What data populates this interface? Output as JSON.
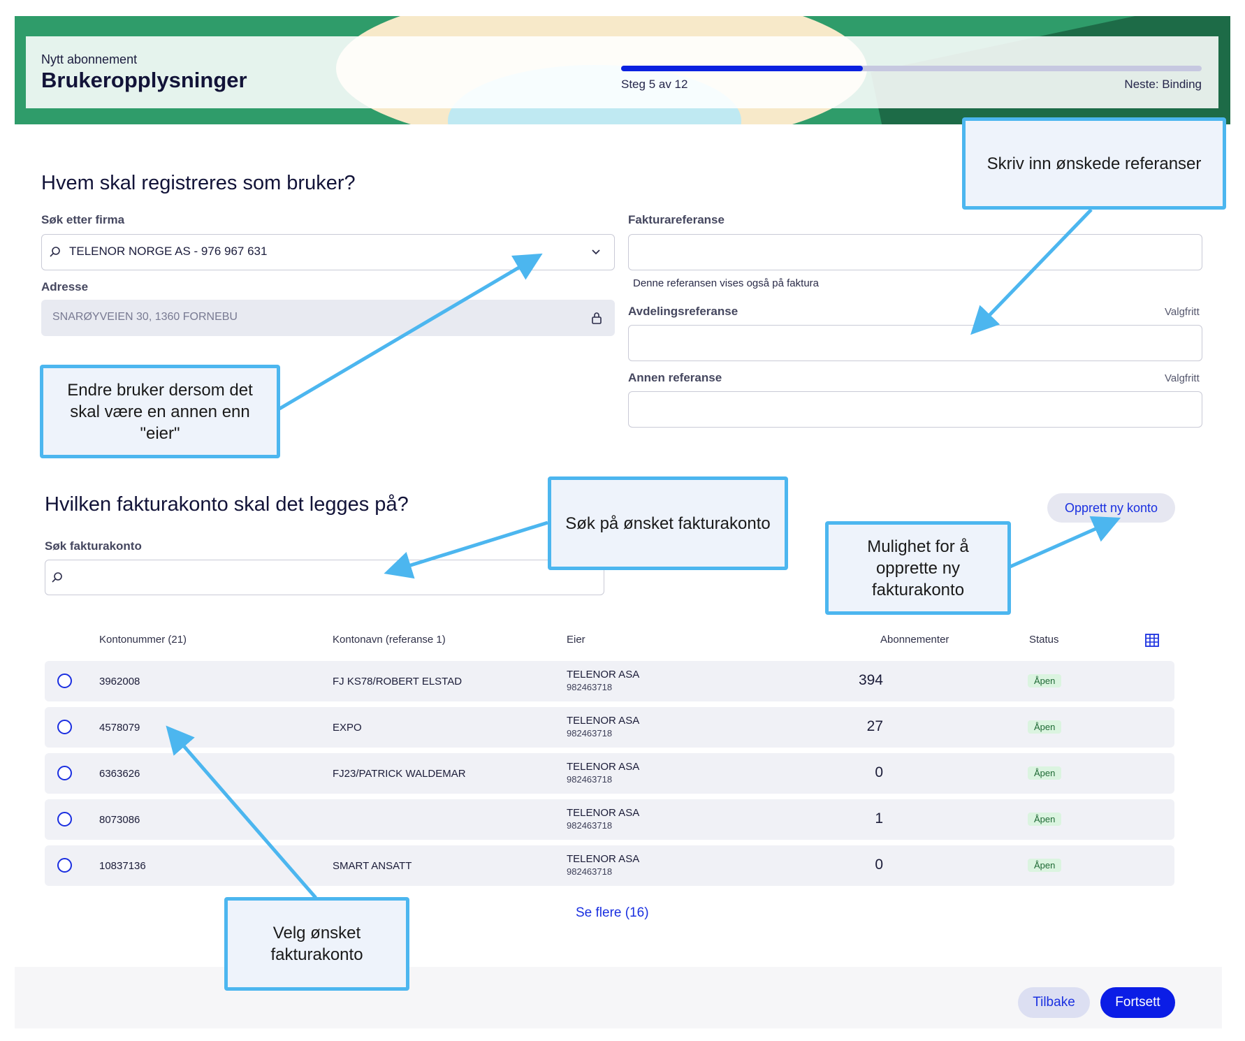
{
  "header": {
    "subtitle": "Nytt abonnement",
    "title": "Brukeropplysninger",
    "step_label": "Steg 5 av 12",
    "next_label": "Neste: Binding",
    "progress_fraction": 0.4167
  },
  "user_section": {
    "heading": "Hvem skal registreres som bruker?",
    "company_search_label": "Søk etter firma",
    "company_value": "TELENOR NORGE AS - 976 967 631",
    "address_label": "Adresse",
    "address_value": "SNARØYVEIEN 30, 1360 FORNEBU",
    "invoice_ref_label": "Fakturareferanse",
    "invoice_ref_value": "",
    "invoice_ref_hint": "Denne referansen vises også på faktura",
    "dept_ref_label": "Avdelingsreferanse",
    "dept_ref_value": "",
    "other_ref_label": "Annen referanse",
    "other_ref_value": "",
    "optional_label": "Valgfritt"
  },
  "account_section": {
    "heading": "Hvilken fakturakonto skal det legges på?",
    "search_label": "Søk fakturakonto",
    "search_value": "",
    "create_button": "Opprett ny konto",
    "columns": {
      "account_number": "Kontonummer (21)",
      "account_name": "Kontonavn (referanse 1)",
      "owner": "Eier",
      "subscriptions": "Abonnementer",
      "status": "Status"
    },
    "rows": [
      {
        "number": "3962008",
        "name": "FJ KS78/ROBERT ELSTAD",
        "owner": "TELENOR ASA",
        "org": "982463718",
        "subscriptions": "394",
        "status": "Åpen"
      },
      {
        "number": "4578079",
        "name": "EXPO",
        "owner": "TELENOR ASA",
        "org": "982463718",
        "subscriptions": "27",
        "status": "Åpen"
      },
      {
        "number": "6363626",
        "name": "FJ23/PATRICK WALDEMAR",
        "owner": "TELENOR ASA",
        "org": "982463718",
        "subscriptions": "0",
        "status": "Åpen"
      },
      {
        "number": "8073086",
        "name": "",
        "owner": "TELENOR ASA",
        "org": "982463718",
        "subscriptions": "1",
        "status": "Åpen"
      },
      {
        "number": "10837136",
        "name": "SMART ANSATT",
        "owner": "TELENOR ASA",
        "org": "982463718",
        "subscriptions": "0",
        "status": "Åpen"
      }
    ],
    "see_more": "Se flere (16)"
  },
  "footer": {
    "back_button": "Tilbake",
    "continue_button": "Fortsett"
  },
  "annotations": {
    "references": "Skriv inn ønskede referanser",
    "change_user": "Endre bruker dersom det skal være en annen enn \"eier\"",
    "search_account": "Søk på ønsket fakturakonto",
    "create_account": "Mulighet for å opprette ny fakturakonto",
    "choose_account": "Velg ønsket fakturakonto"
  },
  "colors": {
    "primary": "#0b1de6",
    "banner_green": "#2f9c6a",
    "callout_border": "#4cb6ef",
    "status_badge_bg": "#dbf4e0"
  },
  "icons": [
    "search-icon",
    "chevron-down-icon",
    "lock-icon",
    "table-settings-icon",
    "radio-icon"
  ]
}
